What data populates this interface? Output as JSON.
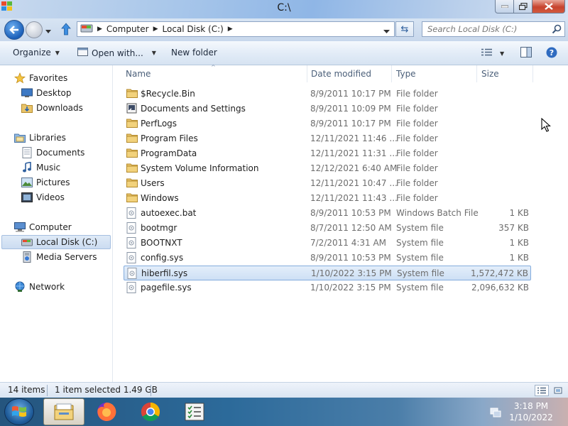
{
  "window": {
    "title": "C:\\"
  },
  "address_bar": {
    "breadcrumbs": [
      "Computer",
      "Local Disk (C:)"
    ]
  },
  "search": {
    "placeholder": "Search Local Disk (C:)"
  },
  "toolbar": {
    "organize": "Organize",
    "open_with": "Open with...",
    "new_folder": "New folder"
  },
  "nav_pane": {
    "favorites_label": "Favorites",
    "favorites": [
      "Desktop",
      "Downloads"
    ],
    "libraries_label": "Libraries",
    "libraries": [
      "Documents",
      "Music",
      "Pictures",
      "Videos"
    ],
    "computer_label": "Computer",
    "computer": [
      "Local Disk (C:)",
      "Media Servers"
    ],
    "network_label": "Network",
    "selected": "Local Disk (C:)"
  },
  "columns": {
    "name": "Name",
    "date": "Date modified",
    "type": "Type",
    "size": "Size"
  },
  "files": [
    {
      "name": "$Recycle.Bin",
      "date": "8/9/2011 10:17 PM",
      "type": "File folder",
      "size": "",
      "icon": "folder-icon"
    },
    {
      "name": "Documents and Settings",
      "date": "8/9/2011 10:09 PM",
      "type": "File folder",
      "size": "",
      "icon": "shortcut-folder-icon"
    },
    {
      "name": "PerfLogs",
      "date": "8/9/2011 10:17 PM",
      "type": "File folder",
      "size": "",
      "icon": "folder-icon"
    },
    {
      "name": "Program Files",
      "date": "12/11/2021 11:46 ...",
      "type": "File folder",
      "size": "",
      "icon": "folder-icon"
    },
    {
      "name": "ProgramData",
      "date": "12/11/2021 11:31 ...",
      "type": "File folder",
      "size": "",
      "icon": "folder-icon"
    },
    {
      "name": "System Volume Information",
      "date": "12/12/2021 6:40 AM",
      "type": "File folder",
      "size": "",
      "icon": "folder-icon"
    },
    {
      "name": "Users",
      "date": "12/11/2021 10:47 ...",
      "type": "File folder",
      "size": "",
      "icon": "folder-icon"
    },
    {
      "name": "Windows",
      "date": "12/11/2021 11:43 ...",
      "type": "File folder",
      "size": "",
      "icon": "folder-icon"
    },
    {
      "name": "autoexec.bat",
      "date": "8/9/2011 10:53 PM",
      "type": "Windows Batch File",
      "size": "1 KB",
      "icon": "batch-file-icon"
    },
    {
      "name": "bootmgr",
      "date": "8/7/2011 12:50 AM",
      "type": "System file",
      "size": "357 KB",
      "icon": "system-file-icon"
    },
    {
      "name": "BOOTNXT",
      "date": "7/2/2011 4:31 AM",
      "type": "System file",
      "size": "1 KB",
      "icon": "system-file-icon"
    },
    {
      "name": "config.sys",
      "date": "8/9/2011 10:53 PM",
      "type": "System file",
      "size": "1 KB",
      "icon": "system-file-icon"
    },
    {
      "name": "hiberfil.sys",
      "date": "1/10/2022 3:15 PM",
      "type": "System file",
      "size": "1,572,472 KB",
      "icon": "system-file-icon",
      "selected": true
    },
    {
      "name": "pagefile.sys",
      "date": "1/10/2022 3:15 PM",
      "type": "System file",
      "size": "2,096,632 KB",
      "icon": "system-file-icon"
    }
  ],
  "status": {
    "item_count": "14 items",
    "selection": "1 item selected  1.49 GB"
  },
  "taskbar": {
    "clock_time": "3:18 PM",
    "clock_date": "1/10/2022"
  }
}
